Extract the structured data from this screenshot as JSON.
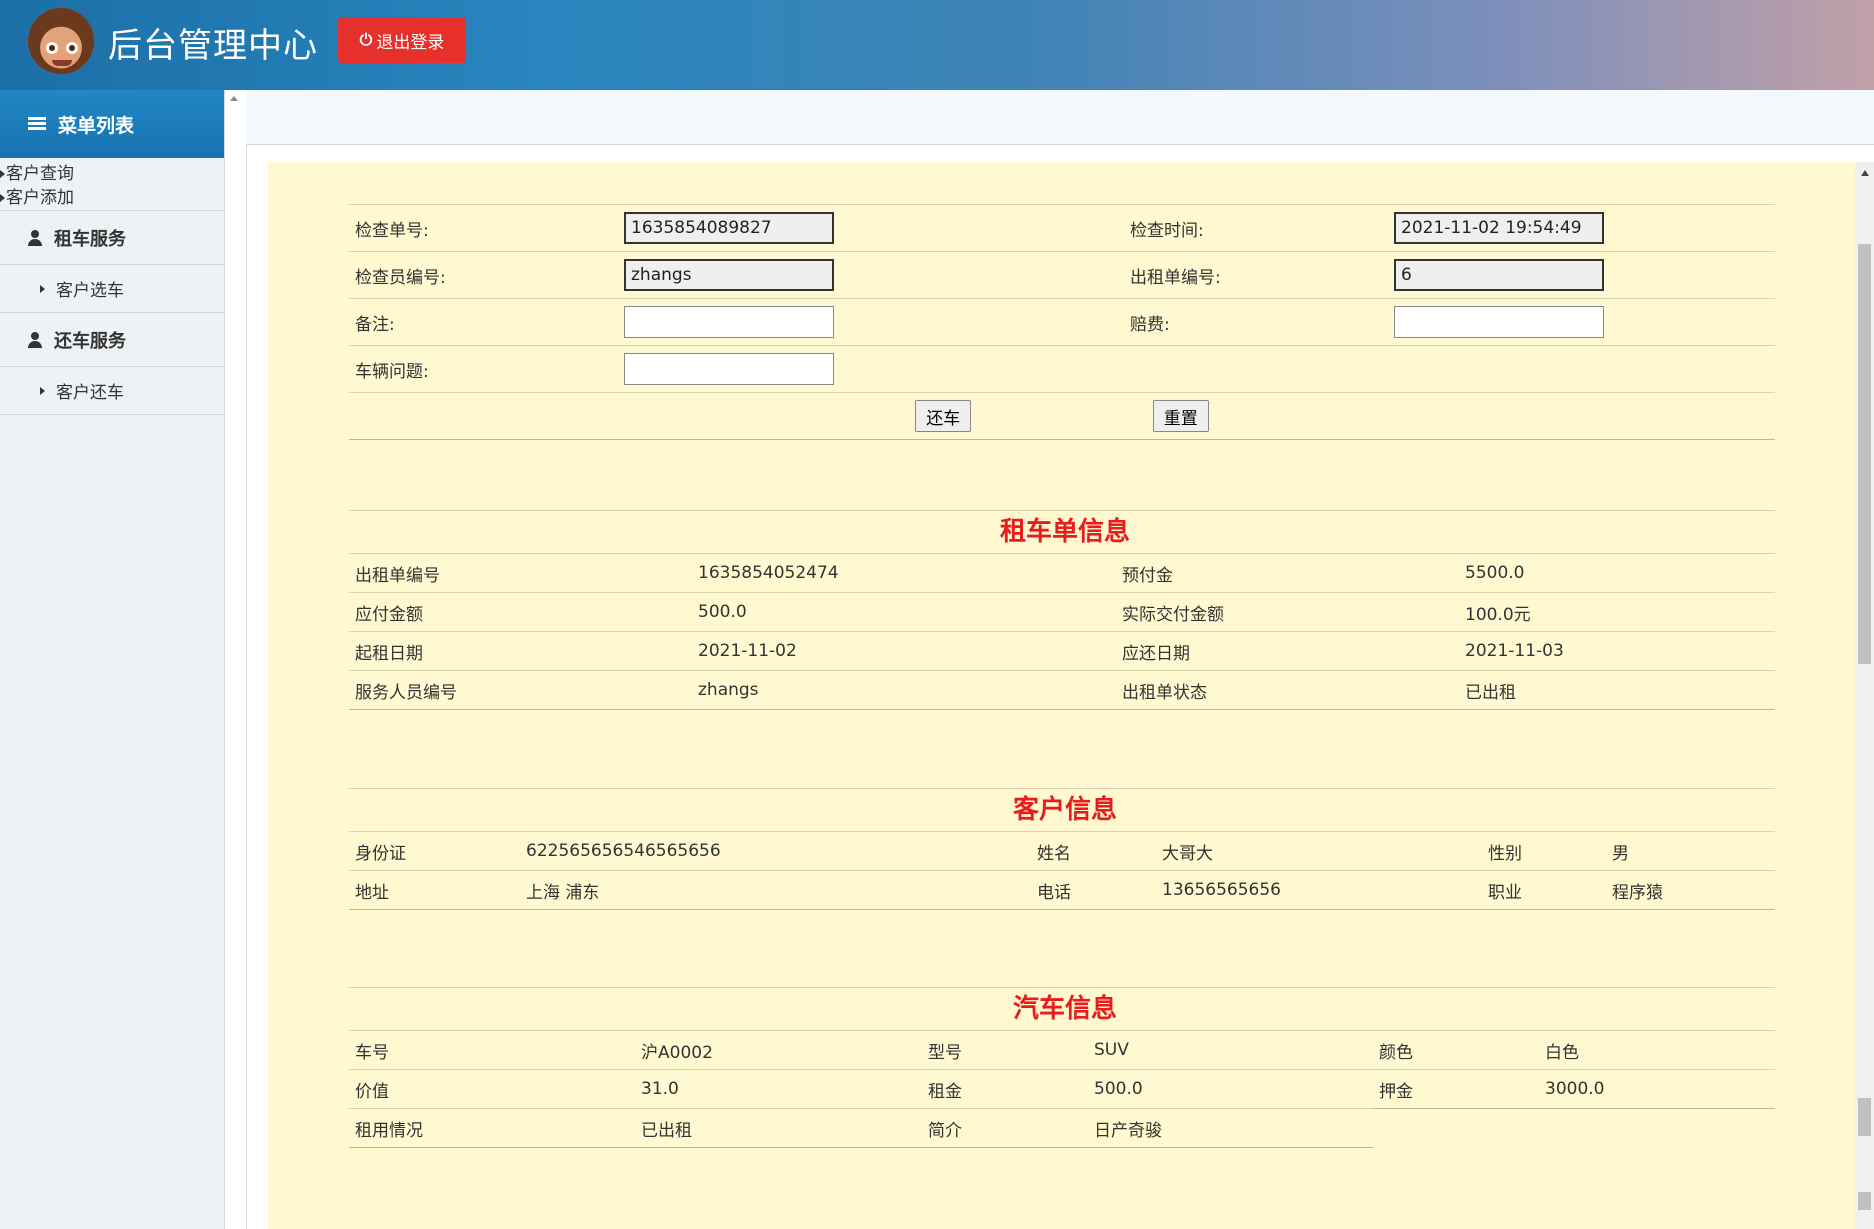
{
  "header": {
    "title": "后台管理中心",
    "logout_label": "退出登录"
  },
  "sidebar": {
    "menu_title": "菜单列表",
    "plain_links": [
      "客户查询",
      "客户添加"
    ],
    "sections": [
      {
        "title": "租车服务",
        "items": [
          "客户选车"
        ]
      },
      {
        "title": "还车服务",
        "items": [
          "客户还车"
        ]
      }
    ]
  },
  "form": {
    "check_no_label": "检查单号:",
    "check_no_value": "1635854089827",
    "check_time_label": "检查时间:",
    "check_time_value": "2021-11-02 19:54:49",
    "inspector_label": "检查员编号:",
    "inspector_value": "zhangs",
    "rent_no_label": "出租单编号:",
    "rent_no_value": "6",
    "remark_label": "备注:",
    "remark_value": "",
    "compensation_label": "赔费:",
    "compensation_value": "",
    "problem_label": "车辆问题:",
    "problem_value": "",
    "return_button": "还车",
    "reset_button": "重置"
  },
  "rental_info": {
    "title": "租车单信息",
    "rows": [
      [
        "出租单编号",
        "1635854052474",
        "预付金",
        "5500.0"
      ],
      [
        "应付金额",
        "500.0",
        "实际交付金额",
        "100.0元"
      ],
      [
        "起租日期",
        "2021-11-02",
        "应还日期",
        "2021-11-03"
      ],
      [
        "服务人员编号",
        "zhangs",
        "出租单状态",
        "已出租"
      ]
    ]
  },
  "customer_info": {
    "title": "客户信息",
    "rows": [
      [
        "身份证",
        "622565656546565656",
        "姓名",
        "大哥大",
        "性别",
        "男"
      ],
      [
        "地址",
        "上海 浦东",
        "电话",
        "13656565656",
        "职业",
        "程序猿"
      ]
    ]
  },
  "car_info": {
    "title": "汽车信息",
    "rows": [
      [
        "车号",
        "沪A0002",
        "型号",
        "SUV",
        "颜色",
        "白色"
      ],
      [
        "价值",
        "31.0",
        "租金",
        "500.0",
        "押金",
        "3000.0"
      ],
      [
        "租用情况",
        "已出租",
        "简介",
        "日产奇骏"
      ]
    ]
  }
}
